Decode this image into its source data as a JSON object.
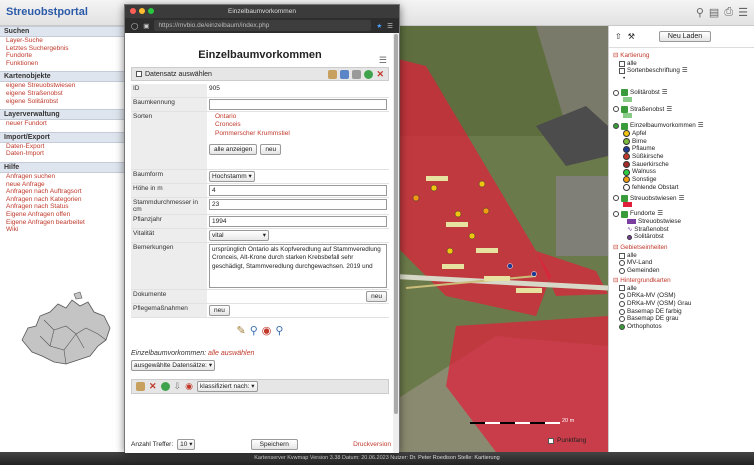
{
  "app": {
    "title": "Streuobstportal"
  },
  "sidebar": {
    "sections": [
      {
        "title": "Suchen",
        "links": [
          "Layer-Suche",
          "Letztes Suchergebnis",
          "Fundorte",
          "Funktionen"
        ]
      },
      {
        "title": "Kartenobjekte",
        "links": [
          "eigene Streuobstwiesen",
          "eigene Straßenobst",
          "eigene Solitärobst"
        ]
      },
      {
        "title": "Layerverwaltung",
        "links": [
          "neuer Fundort"
        ]
      },
      {
        "title": "Import/Export",
        "links": [
          "Daten-Export",
          "Daten-Import"
        ]
      },
      {
        "title": "Hilfe",
        "links": [
          "Anfragen suchen",
          "neue Anfrage",
          "Anfragen nach Auftragsort",
          "Anfragen nach Kategorien",
          "Anfragen nach Status",
          "Eigene Anfragen offen",
          "Eigene Anfragen bearbeitet",
          "Wiki"
        ]
      }
    ]
  },
  "popup": {
    "window_title": "Einzelbaumvorkommen",
    "url": "https://mvbio.de/einzelbaum/index.php",
    "form_title": "Einzelbaumvorkommen",
    "select_record_label": "Datensatz auswählen",
    "fields": {
      "id_label": "ID",
      "id_value": "905",
      "baumkennung_label": "Baumkennung",
      "baumkennung_value": "",
      "sorten_label": "Sorten",
      "sorten": [
        "Ontario",
        "Cronceis",
        "Pommerscher Krummstiel"
      ],
      "alle_anzeigen": "alle anzeigen",
      "neu": "neu",
      "baumform_label": "Baumform",
      "baumform_value": "Hochstamm",
      "hoehe_label": "Höhe in m",
      "hoehe_value": "4",
      "stamm_label": "Stammdurchmesser in cm",
      "stamm_value": "23",
      "pflanzjahr_label": "Pflanzjahr",
      "pflanzjahr_value": "1994",
      "vitalitaet_label": "Vitalität",
      "vitalitaet_value": "vital",
      "bemerkungen_label": "Bemerkungen",
      "bemerkungen_value": "ursprünglich Ontario als Kopfveredlung auf Stammveredlung Cronceis, Alt-Krone durch starken Krebsbefall sehr geschädigt, Stammveredlung durchgewachsen. 2019 und",
      "dokumente_label": "Dokumente",
      "dokumente_btn": "neu",
      "pflege_label": "Pflegemaßnahmen",
      "pflege_btn": "neu"
    },
    "bottom": {
      "text_prefix": "Einzelbaumvorkommen:",
      "text_link": "alle auswählen",
      "selected_select": "ausgewählte Datensätze:",
      "klassifiziert": "klassifiziert nach:",
      "anzahl_label": "Anzahl Treffer:",
      "anzahl_value": "10",
      "speichern": "Speichern",
      "druckversion": "Druckversion"
    }
  },
  "map": {
    "punktfang_label": "Punktfang",
    "scale_end": "20 m"
  },
  "layers": {
    "neu_laden": "Neu Laden",
    "kartierung": "Kartierung",
    "alle": "alle",
    "sortenbeschriftung": "Sortenbeschriftung",
    "solitaerobst": "Solitärobst",
    "strassenobst": "Straßenobst",
    "einzelbaum": "Einzelbaumvorkommen",
    "fruits": [
      {
        "name": "Apfel",
        "color": "#f1c40f"
      },
      {
        "name": "Birne",
        "color": "#7dbb3c"
      },
      {
        "name": "Pflaume",
        "color": "#1f3a93"
      },
      {
        "name": "Süßkirsche",
        "color": "#c0392b"
      },
      {
        "name": "Sauerkirsche",
        "color": "#a52a2a"
      },
      {
        "name": "Walnuss",
        "color": "#2ecc40"
      },
      {
        "name": "Sonstige",
        "color": "#f39c12"
      },
      {
        "name": "fehlende Obstart",
        "color": "#ffffff"
      }
    ],
    "streuobstwiesen": "Streuobstwiesen",
    "fundorte": "Fundorte",
    "fundorte_items": [
      "Streuobstwiese",
      "Straßenobst",
      "Solitärobst"
    ],
    "gebietseinheiten": "Gebietseinheiten",
    "geb_items": [
      "alle",
      "MV-Land",
      "Gemeinden"
    ],
    "hintergrund": "Hintergrundkarten",
    "hg_items": [
      "alle",
      "DRKa-MV (OSM)",
      "DRKa-MV (OSM) Grau",
      "Basemap DE farbig",
      "Basemap DE grau",
      "Orthophotos"
    ]
  },
  "status": {
    "text": "Kartenserver Kvwmap Version 3.38 Datum: 20.06.2023  Nutzer: Dr. Peter Roedison  Stelle: Kartierung"
  }
}
